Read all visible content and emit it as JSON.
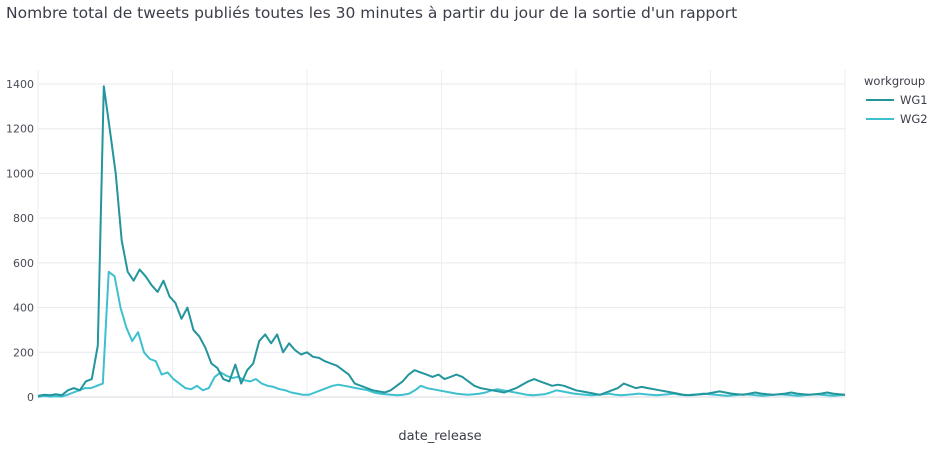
{
  "chart_data": {
    "type": "line",
    "title": "Nombre total de tweets publiés toutes les 30 minutes à partir du jour de la sortie d'un rapport",
    "xlabel": "date_release",
    "ylabel": "",
    "ylim": [
      0,
      1400
    ],
    "yticks": [
      0,
      200,
      400,
      600,
      800,
      1000,
      1200,
      1400
    ],
    "grid": true,
    "legend": {
      "title": "workgroup",
      "placement": "right"
    },
    "series": [
      {
        "name": "WG1",
        "color": "#23959c",
        "values": [
          5,
          10,
          8,
          12,
          8,
          30,
          40,
          30,
          70,
          80,
          230,
          1390,
          1200,
          1000,
          700,
          560,
          520,
          570,
          540,
          500,
          470,
          520,
          450,
          420,
          350,
          400,
          300,
          270,
          220,
          150,
          130,
          80,
          70,
          145,
          60,
          120,
          150,
          250,
          280,
          240,
          280,
          200,
          240,
          210,
          190,
          200,
          180,
          175,
          160,
          150,
          140,
          120,
          100,
          60,
          50,
          40,
          30,
          25,
          20,
          30,
          50,
          70,
          100,
          120,
          110,
          100,
          90,
          100,
          80,
          90,
          100,
          90,
          70,
          50,
          40,
          35,
          30,
          25,
          20,
          30,
          40,
          55,
          70,
          80,
          70,
          60,
          50,
          55,
          50,
          40,
          30,
          25,
          20,
          15,
          10,
          20,
          30,
          40,
          60,
          50,
          40,
          45,
          40,
          35,
          30,
          25,
          20,
          15,
          10,
          8,
          10,
          12,
          15,
          20,
          25,
          20,
          15,
          12,
          10,
          15,
          20,
          15,
          12,
          10,
          12,
          15,
          20,
          15,
          12,
          10,
          12,
          15,
          20,
          15,
          12,
          10
        ]
      },
      {
        "name": "WG2",
        "color": "#3ec0cf",
        "values": [
          0,
          5,
          2,
          3,
          2,
          10,
          20,
          30,
          40,
          40,
          50,
          60,
          560,
          540,
          400,
          310,
          250,
          290,
          200,
          170,
          160,
          100,
          110,
          80,
          60,
          40,
          35,
          50,
          30,
          40,
          90,
          110,
          95,
          85,
          90,
          75,
          70,
          80,
          60,
          50,
          45,
          35,
          30,
          20,
          15,
          10,
          10,
          20,
          30,
          40,
          50,
          55,
          50,
          45,
          40,
          35,
          30,
          20,
          15,
          12,
          10,
          8,
          10,
          15,
          30,
          50,
          40,
          35,
          30,
          25,
          20,
          15,
          12,
          10,
          12,
          15,
          20,
          30,
          35,
          30,
          25,
          20,
          15,
          10,
          8,
          10,
          12,
          20,
          30,
          25,
          20,
          15,
          12,
          10,
          8,
          10,
          12,
          15,
          10,
          8,
          10,
          12,
          15,
          12,
          10,
          8,
          10,
          12,
          15,
          10,
          8,
          10,
          12,
          15,
          12,
          10,
          8,
          6,
          8,
          10,
          12,
          10,
          8,
          6,
          8,
          10,
          12,
          10,
          8,
          6,
          8,
          10,
          12,
          10,
          8,
          6,
          8,
          10
        ]
      }
    ]
  }
}
